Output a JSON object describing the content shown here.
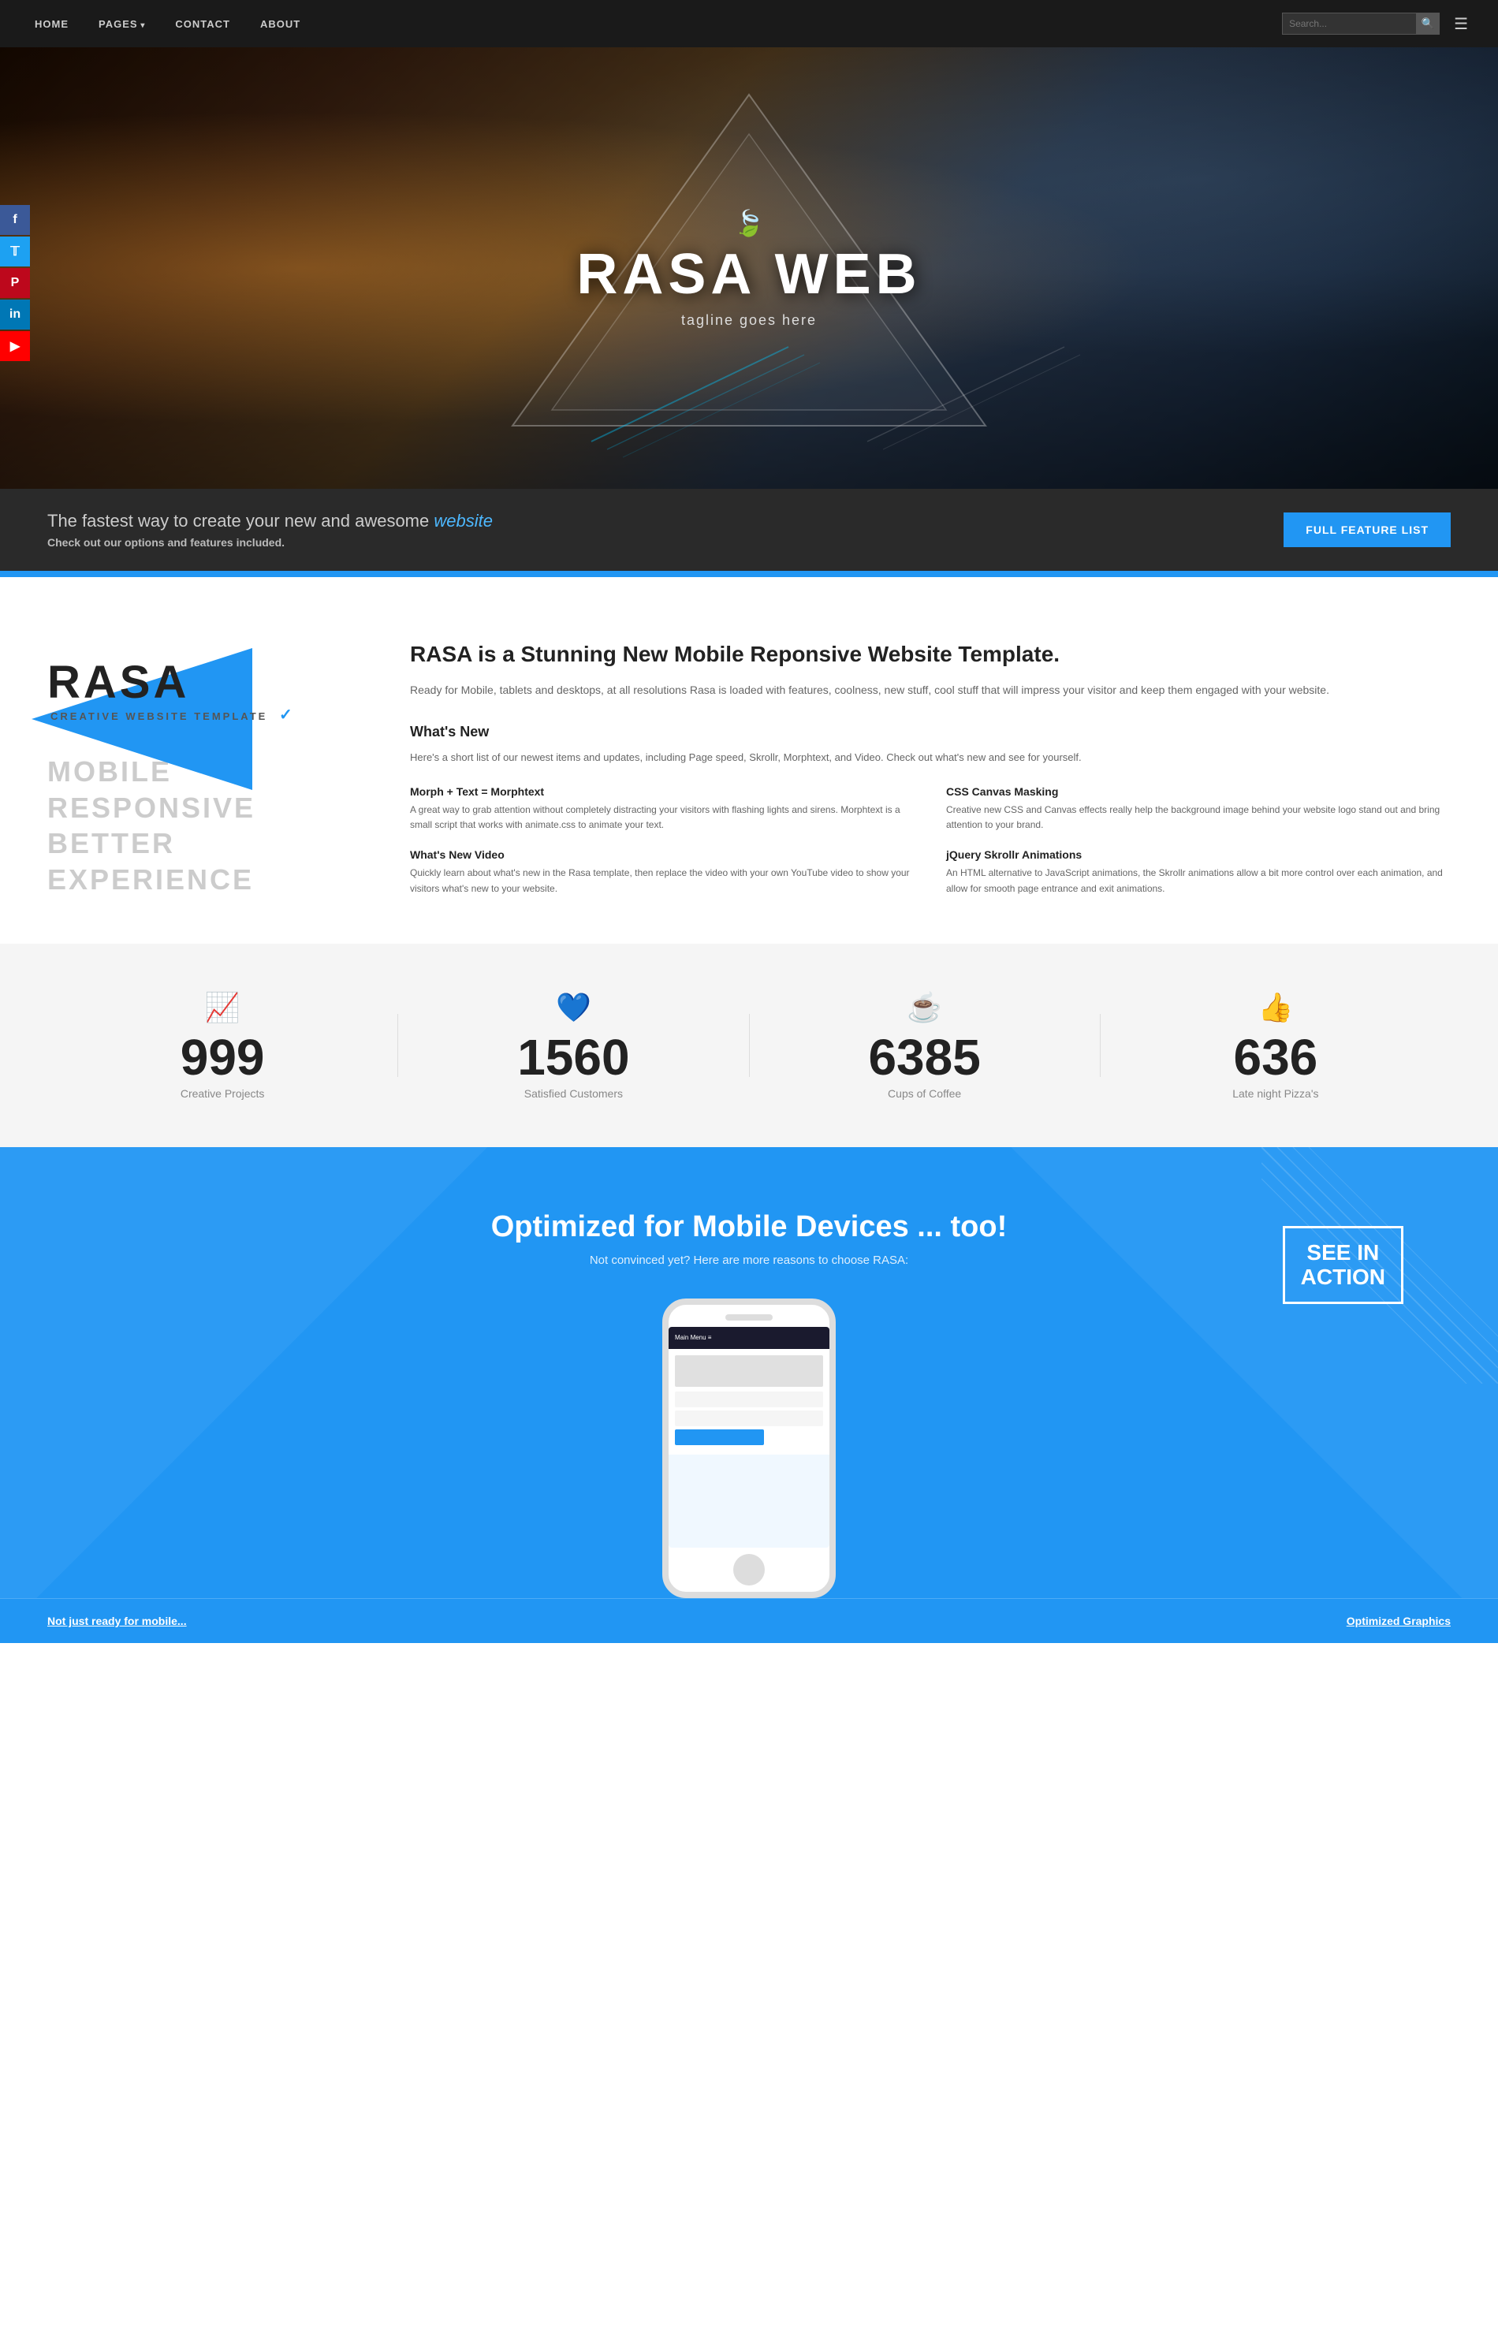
{
  "navbar": {
    "items": [
      {
        "label": "HOME",
        "id": "home",
        "dropdown": false
      },
      {
        "label": "PAGES",
        "id": "pages",
        "dropdown": true
      },
      {
        "label": "CONTACT",
        "id": "contact",
        "dropdown": false
      },
      {
        "label": "ABOUT",
        "id": "about",
        "dropdown": false
      }
    ],
    "search_placeholder": "Search...",
    "search_label": "Search"
  },
  "hero": {
    "title": "RASA WEB",
    "tagline": "tagline goes here",
    "leaf_icon": "🍃"
  },
  "social": {
    "items": [
      {
        "label": "f",
        "name": "facebook",
        "platform": "Facebook"
      },
      {
        "label": "𝕏",
        "name": "twitter",
        "platform": "Twitter"
      },
      {
        "label": "𝗣",
        "name": "pinterest",
        "platform": "Pinterest"
      },
      {
        "label": "in",
        "name": "linkedin",
        "platform": "LinkedIn"
      },
      {
        "label": "▶",
        "name": "youtube",
        "platform": "YouTube"
      }
    ]
  },
  "tagline_section": {
    "text": "The fastest way to create your new and awesome",
    "highlight": "website",
    "subtext": "Check out our options and features included.",
    "button_label": "Full Feature List"
  },
  "about": {
    "logo_text": "RASA",
    "logo_subtitle": "CREATIVE WEBSITE TEMPLATE",
    "title": "RASA is a Stunning New Mobile Reponsive Website Template.",
    "description": "Ready for Mobile, tablets and desktops, at all resolutions Rasa is loaded with features, coolness, new stuff, cool stuff that will impress your visitor and keep them engaged with your website.",
    "mobile_words": [
      "MOBILE",
      "RESPONSIVE",
      "BETTER",
      "EXPERIENCE"
    ]
  },
  "whats_new": {
    "title": "What's New",
    "description": "Here's a short list of our newest items and updates, including Page speed, Skrollr, Morphtext, and Video. Check out what's new and see for yourself.",
    "features": [
      {
        "title": "Morph + Text = Morphtext",
        "description": "A great way to grab attention without completely distracting your visitors with flashing lights and sirens. Morphtext is a small script that works with animate.css to animate your text."
      },
      {
        "title": "CSS Canvas Masking",
        "description": "Creative new CSS and Canvas effects really help the background image behind your website logo stand out and bring attention to your brand."
      },
      {
        "title": "What's New Video",
        "description": "Quickly learn about what's new in the Rasa template, then replace the video with your own YouTube video to show your visitors what's new to your website."
      },
      {
        "title": "jQuery Skrollr Animations",
        "description": "An HTML alternative to JavaScript animations, the Skrollr animations allow a bit more control over each animation, and allow for smooth page entrance and exit animations."
      }
    ]
  },
  "stats": [
    {
      "icon": "📈",
      "number": "999",
      "label": "Creative Projects"
    },
    {
      "icon": "💙",
      "number": "1560",
      "label": "Satisfied Customers"
    },
    {
      "icon": "☕",
      "number": "6385",
      "label": "Cups of Coffee"
    },
    {
      "icon": "👍",
      "number": "636",
      "label": "Late night Pizza's"
    }
  ],
  "mobile_section": {
    "title": "Optimized for Mobile Devices ... too!",
    "subtitle": "Not convinced yet? Here are more reasons to choose RASA:",
    "see_action_label": "SEE IN\nACTION",
    "phone_nav_text": "Main Menu ≡"
  },
  "bottom_links": {
    "left": "Not just ready for mobile...",
    "right": "Optimized Graphics"
  }
}
